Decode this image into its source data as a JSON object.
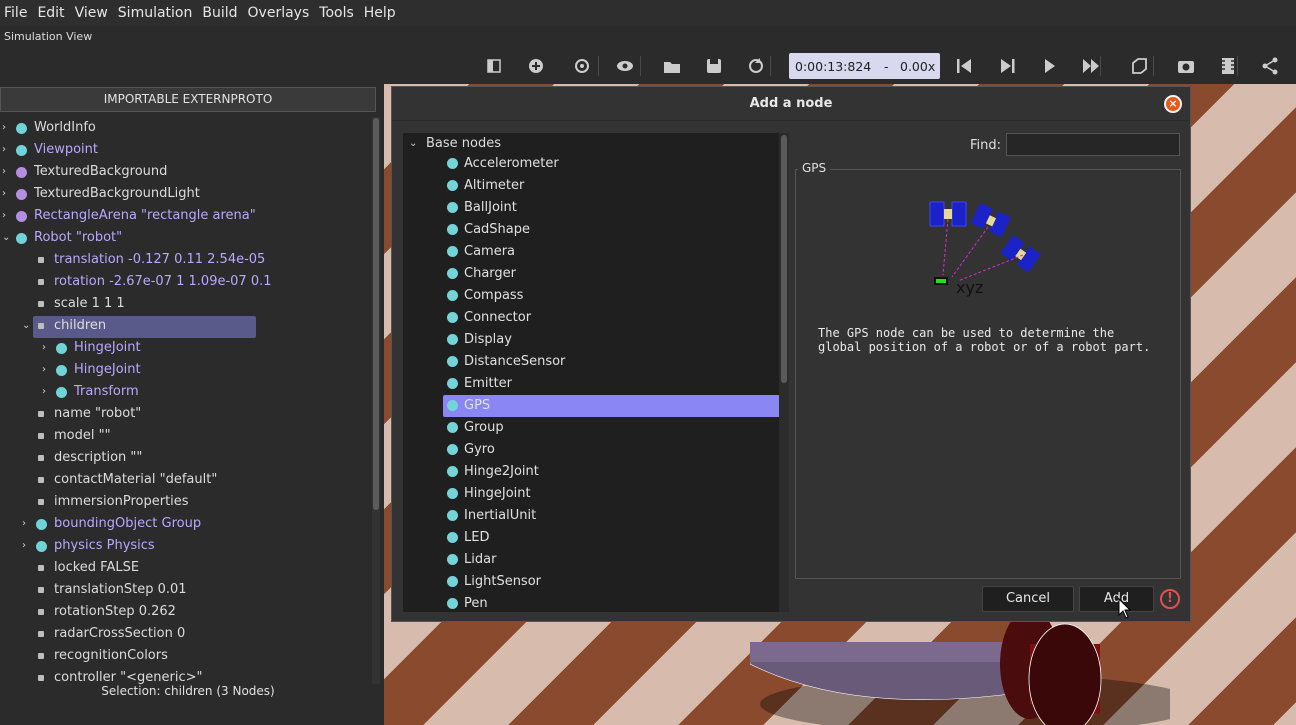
{
  "menu": [
    "File",
    "Edit",
    "View",
    "Simulation",
    "Build",
    "Overlays",
    "Tools",
    "Help"
  ],
  "sim_view_label": "Simulation View",
  "toolbar": {
    "time": "0:00:13:824",
    "speed_sep": "-",
    "speed": "0.00x",
    "icons": [
      "toggle-scene-tree-icon",
      "add-node-icon",
      "reset-view-icon",
      "visibility-icon",
      "open-world-icon",
      "save-world-icon",
      "reload-world-icon",
      "step-back-icon",
      "step-icon",
      "play-icon",
      "fast-forward-icon",
      "3d-view-icon",
      "screenshot-icon",
      "record-movie-icon",
      "share-icon"
    ]
  },
  "left": {
    "externproto_button": "IMPORTABLE EXTERNPROTO",
    "status": "Selection: children (3 Nodes)",
    "tree": [
      {
        "label": "WorldInfo",
        "kind": "node",
        "color": "cyan",
        "indent": 0,
        "expander": "right",
        "purple": false
      },
      {
        "label": "Viewpoint",
        "kind": "node",
        "color": "cyan",
        "indent": 0,
        "expander": "right",
        "purple": true
      },
      {
        "label": "TexturedBackground",
        "kind": "node",
        "color": "violet",
        "indent": 0,
        "expander": "right",
        "purple": false
      },
      {
        "label": "TexturedBackgroundLight",
        "kind": "node",
        "color": "violet",
        "indent": 0,
        "expander": "right",
        "purple": false
      },
      {
        "label": "RectangleArena \"rectangle arena\"",
        "kind": "node",
        "color": "violet",
        "indent": 0,
        "expander": "right",
        "purple": true
      },
      {
        "label": "Robot \"robot\"",
        "kind": "node",
        "color": "cyan",
        "indent": 0,
        "expander": "down",
        "purple": true
      },
      {
        "label": "translation -0.127 0.11 2.54e-05",
        "kind": "field",
        "indent": 1,
        "purple": true
      },
      {
        "label": "rotation -2.67e-07 1 1.09e-07 0.1",
        "kind": "field",
        "indent": 1,
        "purple": true
      },
      {
        "label": "scale 1 1 1",
        "kind": "field",
        "indent": 1,
        "purple": false
      },
      {
        "label": "children",
        "kind": "field",
        "indent": 1,
        "expander": "down",
        "purple": false,
        "selected": true
      },
      {
        "label": "HingeJoint",
        "kind": "node",
        "color": "cyan",
        "indent": 2,
        "expander": "right",
        "purple": true
      },
      {
        "label": "HingeJoint",
        "kind": "node",
        "color": "cyan",
        "indent": 2,
        "expander": "right",
        "purple": true
      },
      {
        "label": "Transform",
        "kind": "node",
        "color": "cyan",
        "indent": 2,
        "expander": "right",
        "purple": true
      },
      {
        "label": "name \"robot\"",
        "kind": "field",
        "indent": 1,
        "purple": false
      },
      {
        "label": "model \"\"",
        "kind": "field",
        "indent": 1,
        "purple": false
      },
      {
        "label": "description \"\"",
        "kind": "field",
        "indent": 1,
        "purple": false
      },
      {
        "label": "contactMaterial \"default\"",
        "kind": "field",
        "indent": 1,
        "purple": false
      },
      {
        "label": "immersionProperties",
        "kind": "field",
        "indent": 1,
        "purple": false
      },
      {
        "label": "boundingObject Group",
        "kind": "node",
        "color": "cyan",
        "indent": 1,
        "expander": "right",
        "purple": true
      },
      {
        "label": "physics Physics",
        "kind": "node",
        "color": "cyan",
        "indent": 1,
        "expander": "right",
        "purple": true
      },
      {
        "label": "locked FALSE",
        "kind": "field",
        "indent": 1,
        "purple": false
      },
      {
        "label": "translationStep 0.01",
        "kind": "field",
        "indent": 1,
        "purple": false
      },
      {
        "label": "rotationStep 0.262",
        "kind": "field",
        "indent": 1,
        "purple": false
      },
      {
        "label": "radarCrossSection 0",
        "kind": "field",
        "indent": 1,
        "purple": false
      },
      {
        "label": "recognitionColors",
        "kind": "field",
        "indent": 1,
        "purple": false
      },
      {
        "label": "controller \"<generic>\"",
        "kind": "field",
        "indent": 1,
        "purple": false
      }
    ]
  },
  "dialog": {
    "title": "Add a node",
    "base_nodes": "Base nodes",
    "find_label": "Find:",
    "find_value": "",
    "group_label": "GPS",
    "image_caption": "xyz",
    "description": "The GPS node can be used to determine the\nglobal position of a robot or of a robot part.",
    "cancel": "Cancel",
    "add": "Add",
    "selected": "GPS",
    "nodes": [
      "Accelerometer",
      "Altimeter",
      "BallJoint",
      "CadShape",
      "Camera",
      "Charger",
      "Compass",
      "Connector",
      "Display",
      "DistanceSensor",
      "Emitter",
      "GPS",
      "Group",
      "Gyro",
      "Hinge2Joint",
      "HingeJoint",
      "InertialUnit",
      "LED",
      "Lidar",
      "LightSensor",
      "Pen"
    ]
  },
  "colors": {
    "accent": "#8a86f4",
    "node_dot": "#74d4d8",
    "proto_dot": "#b48ee0",
    "link_text": "#b9a8ff",
    "close": "#e85a1c"
  }
}
